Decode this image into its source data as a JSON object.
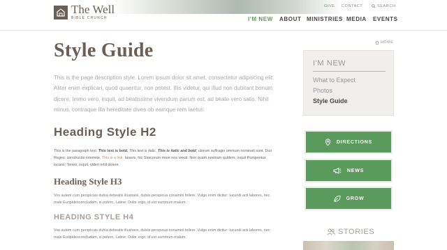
{
  "header": {
    "logo": {
      "name": "The Well",
      "subtitle": "BIBLE CHURCH"
    },
    "utility": {
      "give": "GIVE",
      "contact": "CONTACT",
      "search": "SEARCH"
    },
    "nav": [
      {
        "label": "I'M NEW",
        "active": true
      },
      {
        "label": "ABOUT"
      },
      {
        "label": "MINISTRIES"
      },
      {
        "label": "MEDIA"
      },
      {
        "label": "EVENTS"
      }
    ]
  },
  "breadcrumb": {
    "home": "HOME"
  },
  "main": {
    "title": "Style Guide",
    "description": "This is the page description style. Lorem ipsum dolor sit amet, consectetur adipiscing elit. Aliter enim explicari, quod quaeritur, non potest. Illis videtur, qui illud non dubitant bonum dicere; Immo vero, inquit, ad beatissime vivendum parum est, ad beate vero satis. Nihil minus, contraque illa hereditate dives ob eamque rem laetus.",
    "h2": "Heading Style H2",
    "paragraph": {
      "lead": "This is the paragraph text. ",
      "bold": "This text is bold.",
      "italic": " This text is italic. ",
      "bold_italic": "This is italic and bold",
      "mid": ", ulorum suffragio omnium nominati sunt. Duo Reges: constructio interrete. ",
      "link": "This is a link.",
      "tail": " Iaravis, hic Stoicorum more nos vexat. Non quam nostram quidem, inquit Pomponius iocans; Teneo, inquit, videri nihil dolere."
    },
    "h3": "Heading Style H3",
    "h3_text": "Vos autem cum perspicuis dubia debeatis illustrare, dubiis perspicua conamini tollere. Vulgo enim dicitur: Iucundi acti labores, nec male Euripidesconcludam, si potero, Latine; Dolor ergo, id est summum malum.",
    "h4": "HEADING STYLE H4",
    "h4_text": "Vos autem cum perspicuis dubia debeatis illustrare, dubiis perspicua conamini tollere. Vulgo enim dicitur: Iucundi acti labores, nec male Euripidesconcludam, si potero, Latine; Dolor ergo, id est summum malum."
  },
  "sidebar": {
    "title": "I'M NEW",
    "items": [
      {
        "label": "What to Expect"
      },
      {
        "label": "Photos"
      },
      {
        "label": "Style Guide",
        "active": true
      }
    ]
  },
  "cta": [
    {
      "label": "DIRECTIONS",
      "icon": "map-pin-icon"
    },
    {
      "label": "NEWS",
      "icon": "megaphone-icon"
    },
    {
      "label": "GROW",
      "icon": "leaf-icon"
    }
  ],
  "stories": {
    "label": "STORIES",
    "icon": "people-icon"
  },
  "colors": {
    "brand": "#6b5e55",
    "accent_green": "#5a9a5d",
    "link": "#d67d52",
    "sidebar_bg": "#f0efec"
  }
}
